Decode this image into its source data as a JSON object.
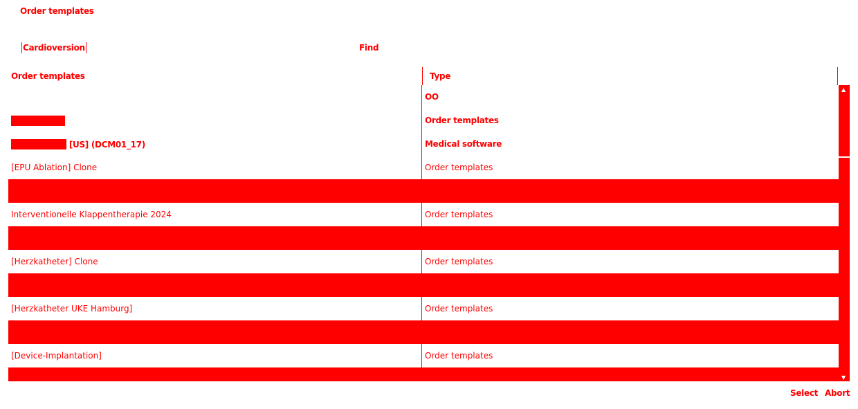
{
  "dialog": {
    "title": "Order templates"
  },
  "search": {
    "value": "Cardioversion",
    "find_label": "Find"
  },
  "table": {
    "columns": [
      "Order templates",
      "Type"
    ],
    "rows": [
      {
        "name": "",
        "type": "OO",
        "style": "white"
      },
      {
        "name": "",
        "type": "Order templates",
        "style": "white",
        "highlight": true
      },
      {
        "name": "[US] (DCM01_17)",
        "type": "Medical software",
        "style": "white",
        "highlight": true
      },
      {
        "name": "[EPU Ablation] Clone",
        "type": "Order templates",
        "style": "white"
      },
      {
        "name": "",
        "type": "",
        "style": "red"
      },
      {
        "name": "Interventionelle Klappentherapie 2024",
        "type": "Order templates",
        "style": "white"
      },
      {
        "name": "",
        "type": "",
        "style": "red"
      },
      {
        "name": "[Herzkatheter] Clone",
        "type": "Order templates",
        "style": "white"
      },
      {
        "name": "",
        "type": "",
        "style": "red"
      },
      {
        "name": "[Herzkatheter UKE Hamburg]",
        "type": "Order templates",
        "style": "white"
      },
      {
        "name": "",
        "type": "",
        "style": "red"
      },
      {
        "name": "[Device-Implantation]",
        "type": "Order templates",
        "style": "white"
      }
    ]
  },
  "footer": {
    "select_label": "Select",
    "abort_label": "Abort"
  },
  "colors": {
    "accent": "#ff0000",
    "background": "#ffffff"
  }
}
